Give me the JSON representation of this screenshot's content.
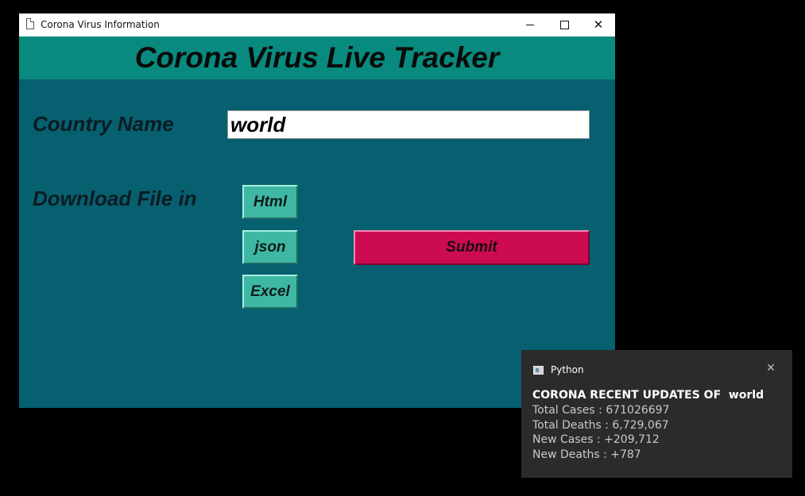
{
  "window": {
    "title": "Corona Virus Information",
    "header": "Corona Virus Live Tracker"
  },
  "form": {
    "country_label": "Country Name",
    "country_value": "world",
    "download_label": "Download File in",
    "format_buttons": [
      "Html",
      "json",
      "Excel"
    ],
    "submit_label": "Submit"
  },
  "notification": {
    "app_name": "Python",
    "title": "CORONA RECENT UPDATES OF  world",
    "lines": [
      "Total Cases : 671026697",
      "Total Deaths : 6,729,067",
      "New Cases : +209,712",
      "New Deaths : +787"
    ]
  },
  "colors": {
    "window_bg": "#066070",
    "header_bg": "#088a7e",
    "format_button": "#3fb8a3",
    "submit_button": "#cc0b50",
    "toast_bg": "#2b2b2b"
  },
  "icons": {
    "window_icon": "document-icon",
    "minimize": "minimize-icon",
    "maximize": "maximize-icon",
    "close": "close-icon",
    "toast_app": "python-app-icon",
    "toast_close": "close-icon"
  }
}
